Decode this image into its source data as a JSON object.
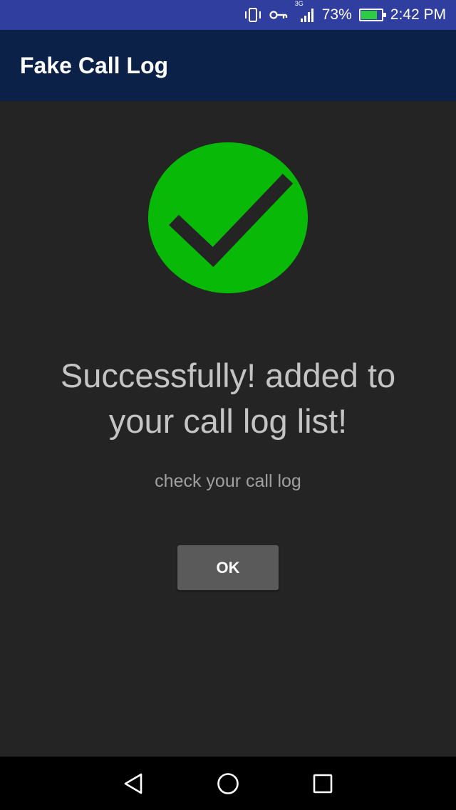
{
  "status_bar": {
    "network": "3G",
    "battery_percent": "73%",
    "battery_level": 0.73,
    "time": "2:42 PM"
  },
  "app_bar": {
    "title": "Fake Call Log"
  },
  "content": {
    "headline_line1": "Successfully! added to",
    "headline_line2": "your call log list!",
    "subtext": "check your call log",
    "ok_label": "OK",
    "success_icon": "checkmark-circle-icon"
  },
  "nav_bar": {
    "back_icon": "back-triangle-icon",
    "home_icon": "home-circle-icon",
    "recents_icon": "recents-square-icon"
  },
  "colors": {
    "status_bar": "#303f9f",
    "app_bar": "#0c2148",
    "background": "#242424",
    "success_green": "#08b908",
    "button": "#5a5a5a",
    "nav_bar": "#000000"
  }
}
